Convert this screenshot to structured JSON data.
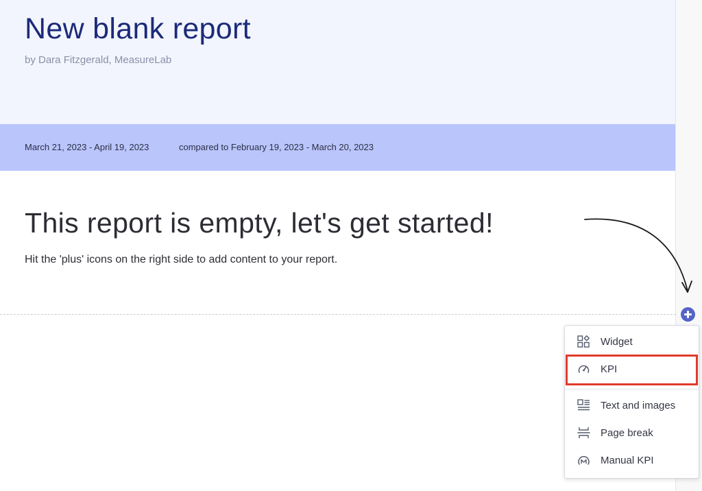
{
  "report": {
    "title": "New blank report",
    "author": "by Dara Fitzgerald, MeasureLab",
    "date_range": "March 21, 2023 - April 19, 2023",
    "compare_range": "compared to February 19, 2023 - March 20, 2023"
  },
  "empty_state": {
    "heading": "This report is empty, let's get started!",
    "hint": "Hit the 'plus' icons on the right side to add content to your report."
  },
  "add_menu": {
    "items": [
      {
        "label": "Widget",
        "icon": "widget-icon"
      },
      {
        "label": "KPI",
        "icon": "gauge-icon"
      },
      {
        "label": "Text and images",
        "icon": "text-image-icon"
      },
      {
        "label": "Page break",
        "icon": "page-break-icon"
      },
      {
        "label": "Manual KPI",
        "icon": "manual-kpi-icon"
      }
    ],
    "highlighted": "KPI"
  },
  "colors": {
    "title": "#1c2a78",
    "header_bg": "#f2f5fe",
    "date_bar_bg": "#bac5fc",
    "plus_button": "#5463c8",
    "highlight": "#e13a2a"
  }
}
